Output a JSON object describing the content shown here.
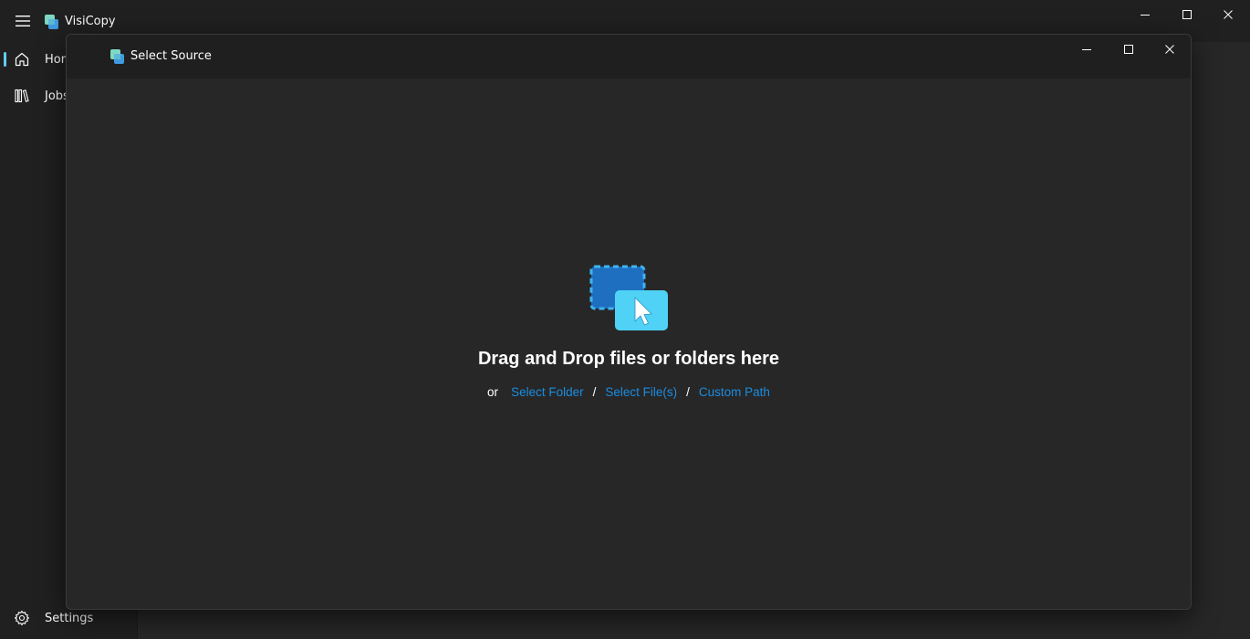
{
  "app": {
    "title": "VisiCopy",
    "accent": "#60cdff"
  },
  "nav": {
    "items": [
      {
        "label": "Home",
        "icon": "home-icon"
      },
      {
        "label": "Jobs",
        "icon": "library-icon"
      }
    ],
    "footer": {
      "label": "Settings",
      "icon": "gear-icon"
    }
  },
  "dialog": {
    "title": "Select Source",
    "heading": "Drag and Drop files or folders here",
    "or_text": "or",
    "links": {
      "select_folder": "Select Folder",
      "select_files": "Select File(s)",
      "custom_path": "Custom Path"
    },
    "separator": "/",
    "link_color": "#1b8de0"
  }
}
